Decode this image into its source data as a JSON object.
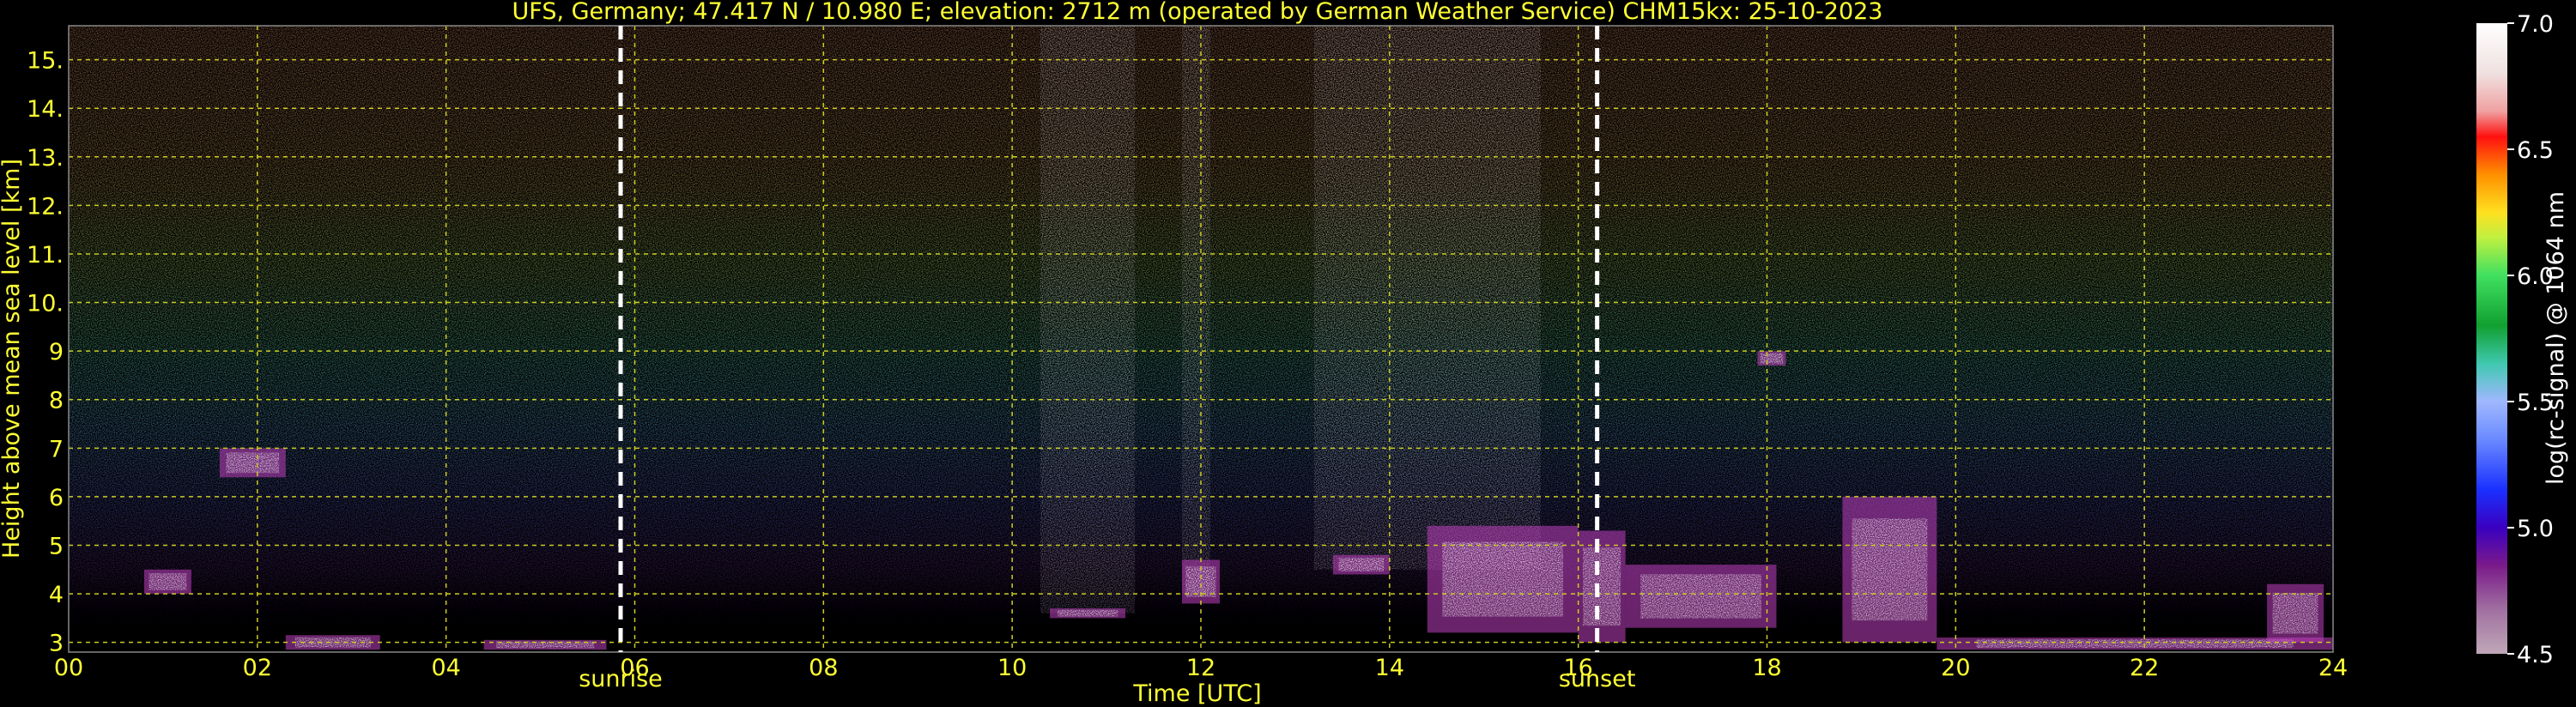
{
  "chart_data": {
    "type": "heatmap",
    "title": "UFS, Germany; 47.417 N / 10.980 E; elevation: 2712 m  (operated by German Weather Service)    CHM15kx: 25-10-2023",
    "xlabel": "Time [UTC]",
    "ylabel": "Height above mean sea level [km]",
    "xlim": [
      0,
      24
    ],
    "ylim": [
      2.8,
      15.7
    ],
    "x_ticks": [
      "00",
      "02",
      "04",
      "06",
      "08",
      "10",
      "12",
      "14",
      "16",
      "18",
      "20",
      "22",
      "24"
    ],
    "y_ticks": [
      "3",
      "4",
      "5",
      "6",
      "7",
      "8",
      "9",
      "10.",
      "11.",
      "12.",
      "13.",
      "14.",
      "15."
    ],
    "grid": true,
    "events": [
      {
        "label": "sunrise",
        "time": 5.85
      },
      {
        "label": "sunset",
        "time": 16.2
      }
    ],
    "colorbar": {
      "label": "log(rc-signal) @ 1064 nm",
      "range": [
        4.5,
        7.0
      ],
      "ticks": [
        "4.5",
        "5.0",
        "5.5",
        "6.0",
        "6.5",
        "7.0"
      ]
    },
    "features": [
      {
        "t0": 0.8,
        "t1": 1.3,
        "h0": 4.0,
        "h1": 4.5,
        "kind": "cloud"
      },
      {
        "t0": 1.6,
        "t1": 2.3,
        "h0": 6.4,
        "h1": 7.0,
        "kind": "cloud"
      },
      {
        "t0": 2.3,
        "t1": 3.3,
        "h0": 2.85,
        "h1": 3.15,
        "kind": "cloud"
      },
      {
        "t0": 4.4,
        "t1": 5.7,
        "h0": 2.85,
        "h1": 3.05,
        "kind": "cloud"
      },
      {
        "t0": 10.4,
        "t1": 11.2,
        "h0": 3.5,
        "h1": 3.7,
        "kind": "cloud"
      },
      {
        "t0": 11.8,
        "t1": 12.2,
        "h0": 3.8,
        "h1": 4.7,
        "kind": "cloud"
      },
      {
        "t0": 13.4,
        "t1": 14.0,
        "h0": 4.4,
        "h1": 4.8,
        "kind": "cloud"
      },
      {
        "t0": 14.4,
        "t1": 16.0,
        "h0": 3.2,
        "h1": 5.4,
        "kind": "cloud"
      },
      {
        "t0": 16.0,
        "t1": 16.5,
        "h0": 3.0,
        "h1": 5.3,
        "kind": "cloud"
      },
      {
        "t0": 16.5,
        "t1": 18.1,
        "h0": 3.3,
        "h1": 4.6,
        "kind": "cloud"
      },
      {
        "t0": 17.9,
        "t1": 18.2,
        "h0": 8.7,
        "h1": 9.0,
        "kind": "cloud"
      },
      {
        "t0": 18.8,
        "t1": 19.8,
        "h0": 3.0,
        "h1": 6.0,
        "kind": "cloud"
      },
      {
        "t0": 19.8,
        "t1": 24.0,
        "h0": 2.85,
        "h1": 3.1,
        "kind": "cloud"
      },
      {
        "t0": 23.3,
        "t1": 23.9,
        "h0": 3.0,
        "h1": 4.2,
        "kind": "cloud"
      }
    ],
    "signal_bands": [
      {
        "t0": 10.3,
        "t1": 11.3,
        "h0": 3.6,
        "h1": 15.7
      },
      {
        "t0": 11.8,
        "t1": 12.1,
        "h0": 4.0,
        "h1": 15.7
      },
      {
        "t0": 13.2,
        "t1": 14.1,
        "h0": 4.5,
        "h1": 15.7
      },
      {
        "t0": 14.1,
        "t1": 15.6,
        "h0": 4.5,
        "h1": 15.7
      }
    ]
  },
  "colors": {
    "text": "#ffff33",
    "grid": "#cccc22",
    "background": "#000000",
    "event_line": "#ffffff"
  }
}
